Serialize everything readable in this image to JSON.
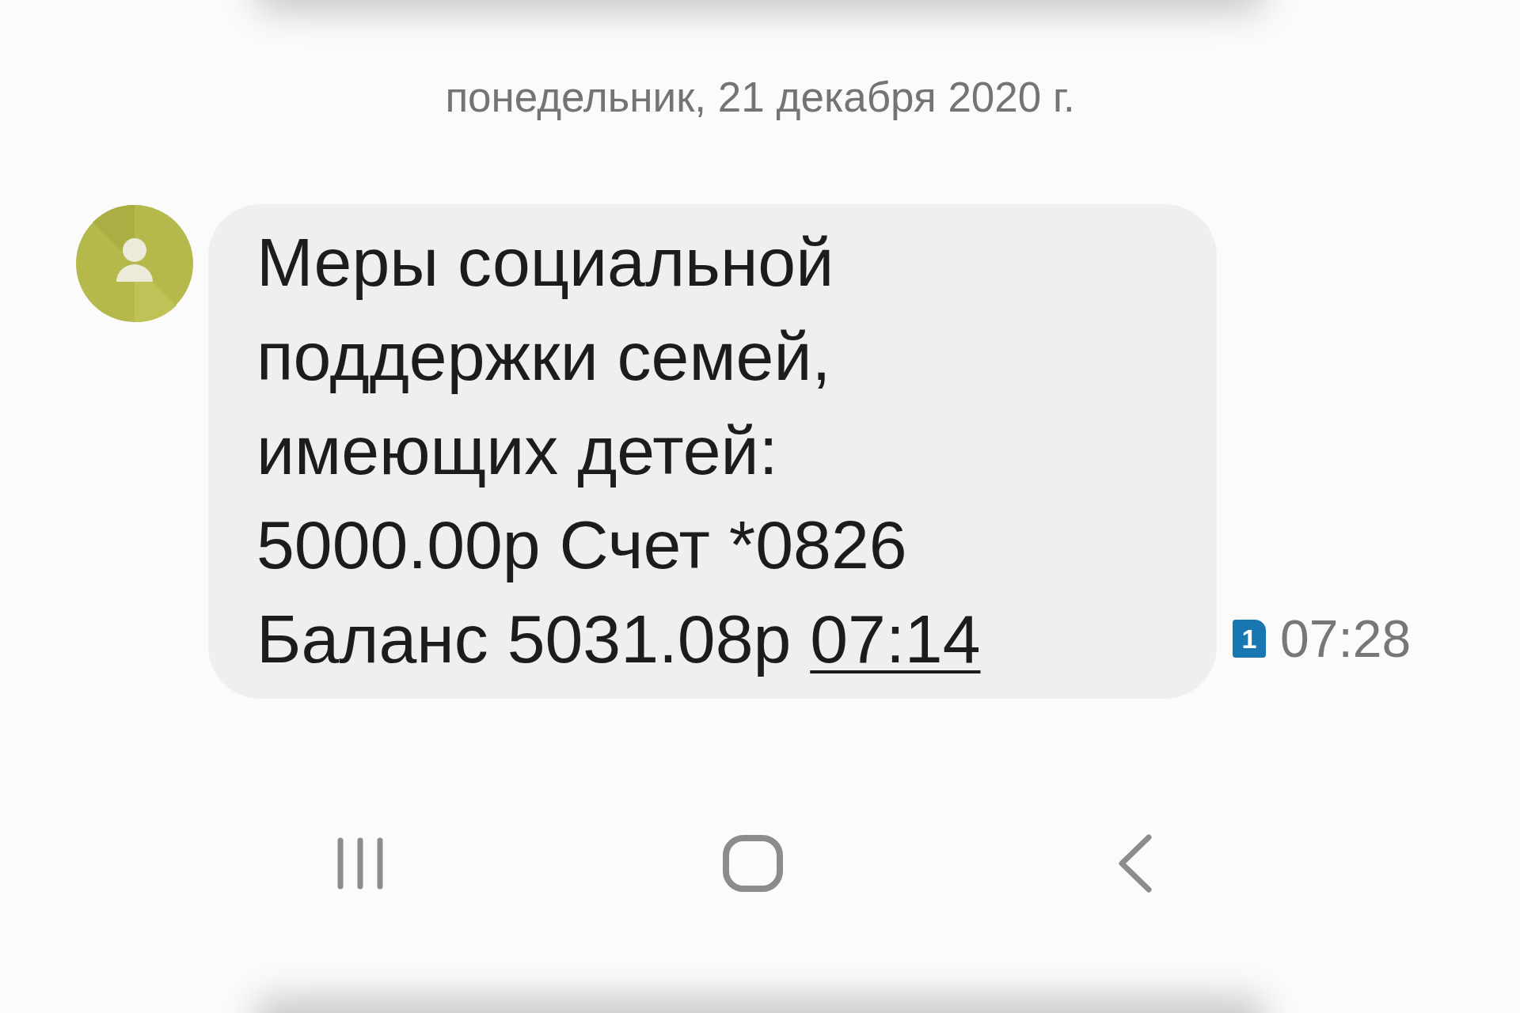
{
  "date_header": "понедельник, 21 декабря 2020 г.",
  "message": {
    "lines": [
      "Меры социальной",
      "поддержки семей,",
      "имеющих детей:",
      "5000.00р Счет *0826",
      "Баланс 5031.08р"
    ],
    "link": "07:14",
    "sim": "1",
    "time": "07:28"
  }
}
